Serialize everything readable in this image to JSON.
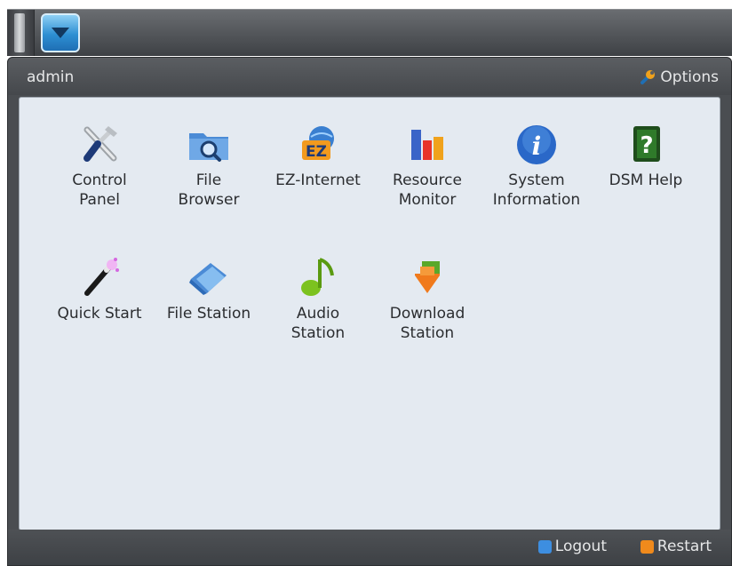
{
  "header": {
    "user": "admin",
    "options_label": "Options"
  },
  "apps": [
    {
      "label": "Control\nPanel",
      "icon": "tools-icon"
    },
    {
      "label": "File\nBrowser",
      "icon": "folder-search-icon"
    },
    {
      "label": "EZ-Internet",
      "icon": "ez-globe-icon"
    },
    {
      "label": "Resource\nMonitor",
      "icon": "bar-chart-icon"
    },
    {
      "label": "System\nInformation",
      "icon": "info-icon"
    },
    {
      "label": "DSM Help",
      "icon": "help-book-icon"
    },
    {
      "label": "Quick Start",
      "icon": "magic-wand-icon"
    },
    {
      "label": "File Station",
      "icon": "folder-icon"
    },
    {
      "label": "Audio\nStation",
      "icon": "music-note-icon"
    },
    {
      "label": "Download\nStation",
      "icon": "download-arrow-icon"
    }
  ],
  "footer": {
    "logout_label": "Logout",
    "restart_label": "Restart"
  },
  "colors": {
    "logout_accent": "#3d8ee0",
    "restart_accent": "#f08a1c"
  }
}
